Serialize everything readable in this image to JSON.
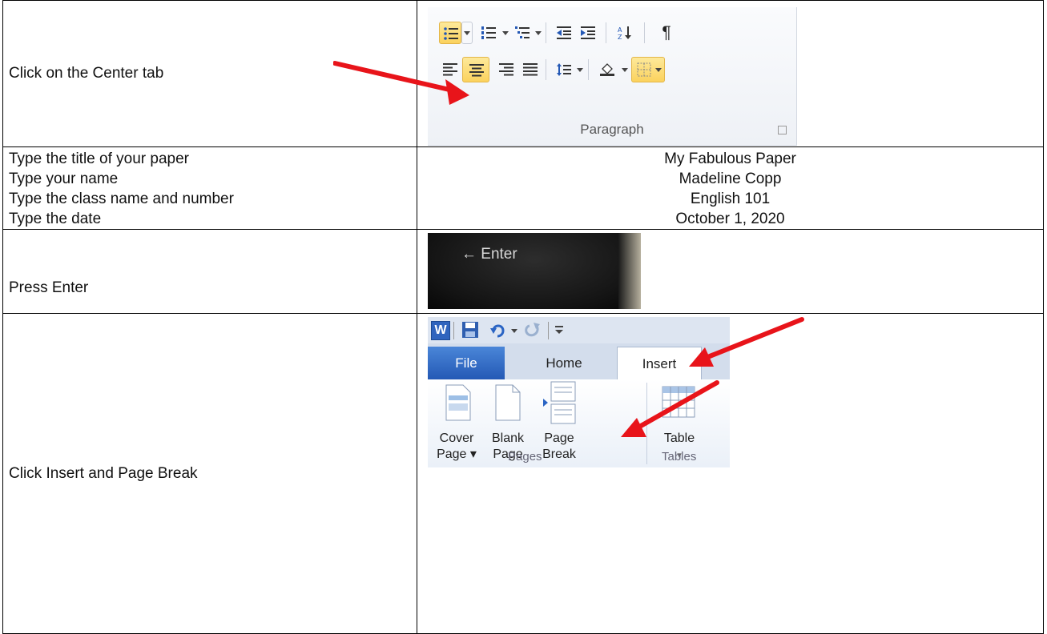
{
  "rows": [
    {
      "instruction": "Click on the Center tab"
    },
    {
      "instructions": [
        "Type the title of your paper",
        "Type your name",
        "Type the class name and number",
        "Type the date"
      ],
      "values": [
        "My Fabulous Paper",
        "Madeline Copp",
        "English 101",
        "October 1, 2020"
      ]
    },
    {
      "instruction": "Press Enter"
    },
    {
      "instruction": "Click Insert and Page Break"
    }
  ],
  "paragraph_ribbon": {
    "group_label": "Paragraph",
    "pilcrow": "¶"
  },
  "enter_key": {
    "label": "Enter",
    "arrow": "←"
  },
  "word_ribbon": {
    "app_icon": "W",
    "tabs": {
      "file": "File",
      "home": "Home",
      "insert": "Insert"
    },
    "buttons": {
      "cover_page": [
        "Cover",
        "Page ▾"
      ],
      "blank_page": [
        "Blank",
        "Page"
      ],
      "page_break": [
        "Page",
        "Break"
      ],
      "table": [
        "Table",
        "▾"
      ]
    },
    "groups": {
      "pages": "Pages",
      "tables": "Tables"
    }
  },
  "colors": {
    "arrow": "#e8141a",
    "file_tab": "#2e66c3",
    "selected": "#fbd25e"
  }
}
